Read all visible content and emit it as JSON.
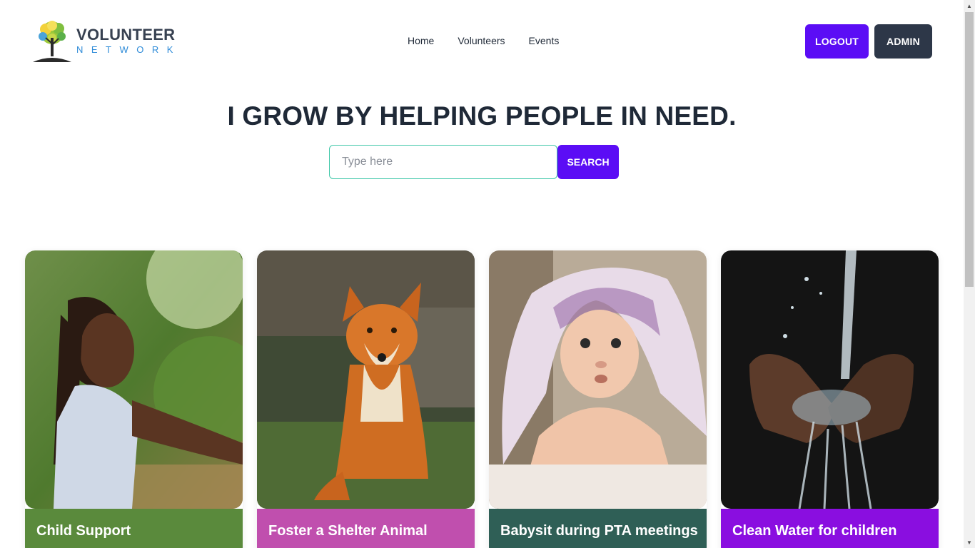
{
  "header": {
    "logo_title": "VOLUNTEER",
    "logo_subtitle": "NETWORK",
    "nav": [
      "Home",
      "Volunteers",
      "Events"
    ],
    "logout_label": "LOGOUT",
    "admin_label": "ADMIN"
  },
  "hero": {
    "title": "I GROW BY HELPING PEOPLE IN NEED.",
    "search_placeholder": "Type here",
    "search_label": "SEARCH"
  },
  "cards": [
    {
      "title": "Child Support",
      "color": "#5a8a3c"
    },
    {
      "title": "Foster a Shelter Animal",
      "color": "#c04fae"
    },
    {
      "title": "Babysit during PTA meetings",
      "color": "#2f5f56"
    },
    {
      "title": "Clean Water for children",
      "color": "#8a0ee0"
    }
  ],
  "colors": {
    "primary": "#5b0df5",
    "dark": "#2d3748",
    "input_border": "#3ec7a8"
  }
}
